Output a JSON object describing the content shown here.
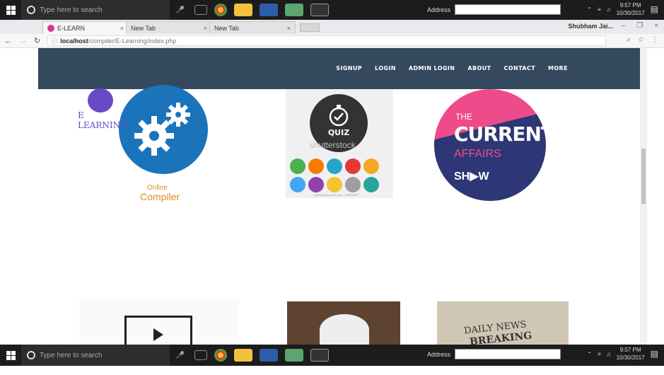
{
  "taskbar": {
    "search_placeholder": "Type here to search",
    "address_label": "Address",
    "time": "9:57 PM",
    "date": "10/30/2017"
  },
  "browser": {
    "tabs": [
      {
        "label": "E-LEARN"
      },
      {
        "label": "New Tab"
      },
      {
        "label": "New Tab"
      }
    ],
    "profile": "Shubham Jai...",
    "url_host": "localhost",
    "url_path": "/compiler/E-Learning/index.php"
  },
  "site": {
    "nav": [
      "SIGNUP",
      "LOGIN",
      "ADMIN LOGIN",
      "ABOUT",
      "CONTACT",
      "MORE"
    ],
    "logo_text": "E LEARNING",
    "compiler_label_1": "Online",
    "compiler_label_2": "Compiler",
    "quiz_label": "QUIZ",
    "quiz_watermark": "shutterstock",
    "quiz_footer": "www.shutterstock.com · 329649797",
    "current_affairs": {
      "l1": "THE",
      "l2": "CURRENT",
      "l3": "AFFAIRS",
      "l4": "SH▶W"
    },
    "news_text_1": "DAILY NEWS",
    "news_text_2": "BREAKING"
  },
  "colors": {
    "navbar": "#34495e",
    "compiler_circle": "#1b73ba",
    "current_affairs_pink": "#ee4b8a",
    "current_affairs_navy": "#2d3775"
  }
}
